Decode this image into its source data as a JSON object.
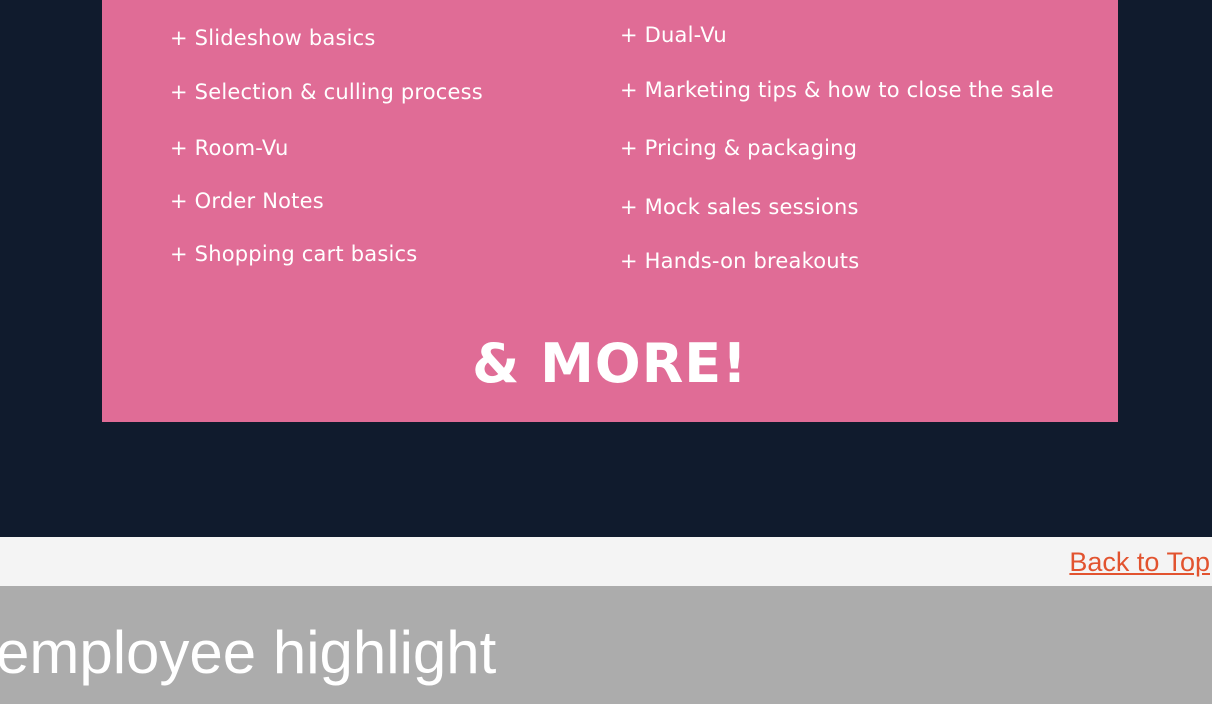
{
  "features": {
    "left": [
      "+ Slideshow basics",
      "+ Selection & culling process",
      "+ Room-Vu",
      "+ Order Notes",
      "+ Shopping cart basics"
    ],
    "right": [
      "+ Dual-Vu",
      "+ Marketing tips & how to close the sale",
      "+ Pricing & packaging",
      "+ Mock sales sessions",
      "+ Hands-on breakouts"
    ]
  },
  "more_text": "& MORE!",
  "back_to_top": "Back to Top",
  "section_title": "employee highlight",
  "colors": {
    "hero_background": "#101b2d",
    "card_background": "#e06c96",
    "link": "#e2532f",
    "section_header": "#acacac"
  }
}
